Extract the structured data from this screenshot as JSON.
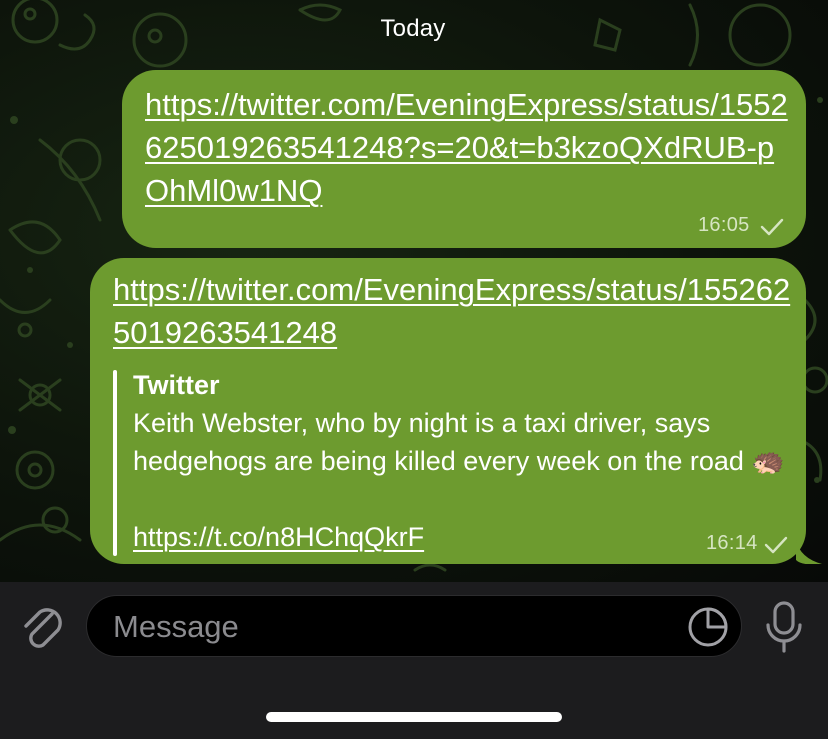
{
  "date_header": "Today",
  "messages": [
    {
      "text": "https://twitter.com/EveningExpress/status/1552625019263541248?s=20&t=b3kzoQXdRUB-pOhMl0w1NQ",
      "time": "16:05"
    },
    {
      "text": "https://twitter.com/EveningExpress/status/1552625019263541248",
      "time": "16:14",
      "preview": {
        "site": "Twitter",
        "description": "Keith Webster, who by night is a taxi driver, says hedgehogs are being killed every week on the road 🦔",
        "link": "https://t.co/n8HChqQkrF"
      }
    }
  ],
  "composer": {
    "placeholder": "Message",
    "icons": [
      "paperclip-icon",
      "sticker-icon",
      "microphone-icon"
    ]
  },
  "colors": {
    "bubble": "#6d9b2f",
    "background": "#0d140b",
    "composer": "#1c1c1e"
  }
}
